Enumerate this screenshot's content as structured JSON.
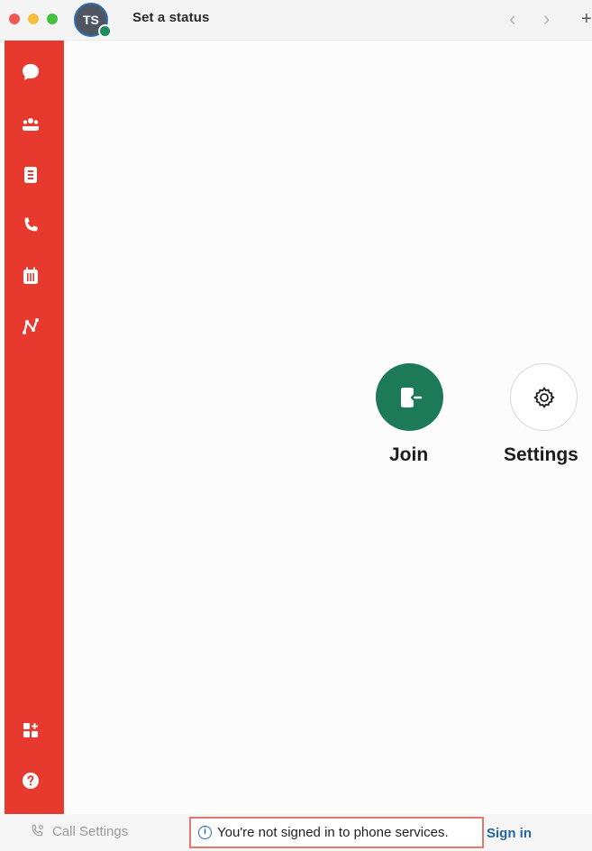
{
  "titlebar": {
    "avatar_initials": "TS",
    "status_text": "Set a status",
    "back_glyph": "‹",
    "forward_glyph": "›",
    "add_glyph": "+"
  },
  "sidebar": {
    "color": "#e8392f",
    "items": [
      {
        "icon": "chat-bubble-icon"
      },
      {
        "icon": "teams-icon"
      },
      {
        "icon": "contacts-icon"
      },
      {
        "icon": "phone-icon"
      },
      {
        "icon": "calendar-icon"
      },
      {
        "icon": "analytics-icon"
      },
      {
        "icon": "apps-icon"
      },
      {
        "icon": "help-icon"
      }
    ]
  },
  "main": {
    "join_label": "Join",
    "settings_label": "Settings",
    "join_color": "#1d7a58"
  },
  "footer": {
    "call_settings_label": "Call Settings",
    "notice_text": "You're not signed in to phone services.",
    "sign_in_label": "Sign in",
    "link_color": "#2466a8"
  }
}
